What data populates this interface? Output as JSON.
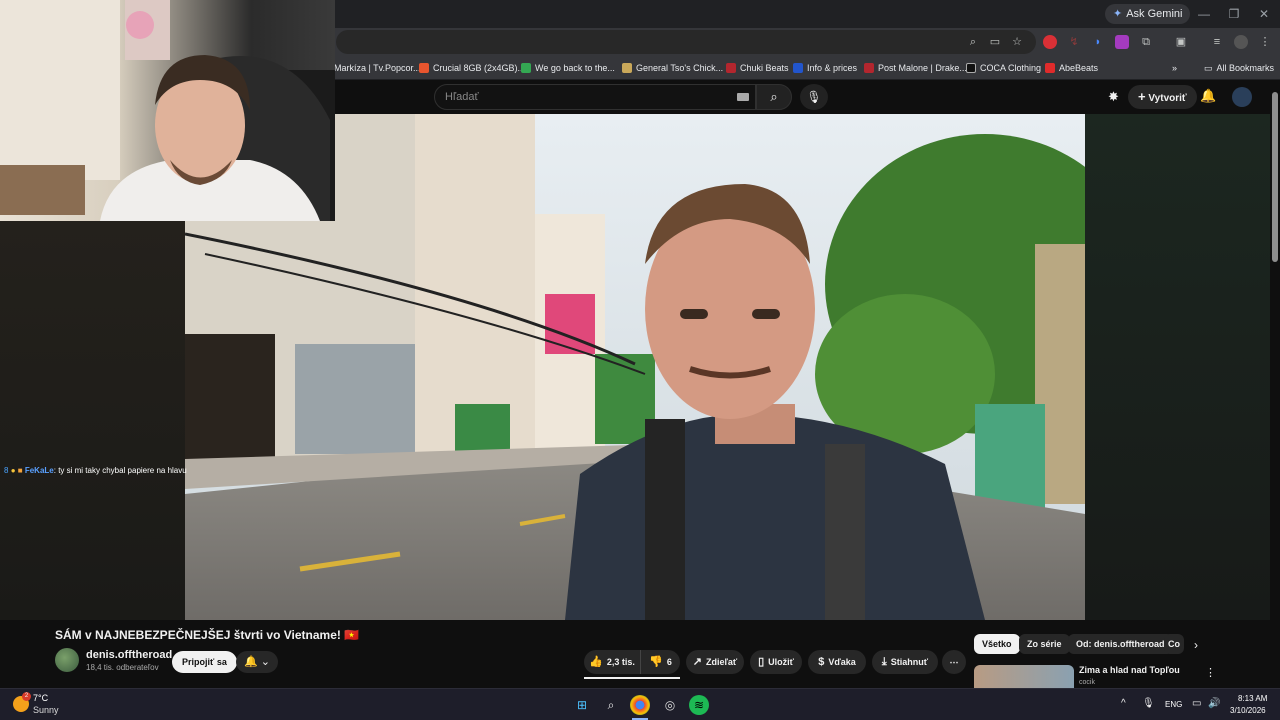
{
  "browser": {
    "ask_gemini_label": "Ask Gemini",
    "bookmarks": [
      {
        "label": "Markíza | Tv.Popcor...",
        "color": "#6b6b6b"
      },
      {
        "label": "Crucial 8GB (2x4GB)...",
        "color": "#e8552e"
      },
      {
        "label": "We go back to the...",
        "color": "#34a853"
      },
      {
        "label": "General Tso's Chick...",
        "color": "#c9a85a"
      },
      {
        "label": "Chuki Beats",
        "color": "#b3262e"
      },
      {
        "label": "Info & prices",
        "color": "#2255cc"
      },
      {
        "label": "Post Malone | Drake...",
        "color": "#b3262e"
      },
      {
        "label": "COCA Clothing",
        "color": "#333333"
      },
      {
        "label": "AbeBeats",
        "color": "#e02b2b"
      }
    ],
    "all_bookmarks_label": "All Bookmarks"
  },
  "youtube": {
    "search_placeholder": "Hľadať",
    "create_label": "Vytvoriť",
    "video": {
      "title": "SÁM v NAJNEBEZPEČNEJŠEJ štvrti vo Vietname! 🇻🇳",
      "channel": "denis.offtheroad",
      "subscribers": "18,4 tis. odberateľov",
      "join_label": "Pripojiť sa",
      "likes": "2,3 tis.",
      "dislikes": "6",
      "share_label": "Zdieľať",
      "save_label": "Uložiť",
      "thanks_label": "Vďaka",
      "download_label": "Stiahnuť"
    },
    "chips": [
      "Všetko",
      "Zo série",
      "Od: denis.offtheroad",
      "Co"
    ],
    "recommendation": {
      "title": "Zima a hlad nad Topľou",
      "channel": "cocik"
    }
  },
  "stream_chat": {
    "user": "FeKaLe",
    "message": ": ty si mi taky chybal papiere na hlavu"
  },
  "taskbar": {
    "weather_temp": "7°C",
    "weather_desc": "Sunny",
    "weather_badge": "2",
    "language": "ENG",
    "time": "8:13 AM",
    "date": "3/10/2026"
  }
}
